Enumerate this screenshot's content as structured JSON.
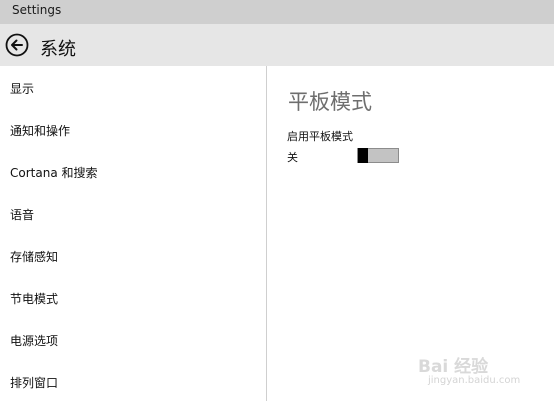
{
  "window": {
    "title": "Settings"
  },
  "header": {
    "title": "系统",
    "back_icon": "back-arrow-icon"
  },
  "sidebar": {
    "items": [
      {
        "label": "显示"
      },
      {
        "label": "通知和操作"
      },
      {
        "label": "Cortana 和搜索"
      },
      {
        "label": "语音"
      },
      {
        "label": "存储感知"
      },
      {
        "label": "节电模式"
      },
      {
        "label": "电源选项"
      },
      {
        "label": "排列窗口"
      }
    ]
  },
  "main": {
    "section_title": "平板模式",
    "setting_label": "启用平板模式",
    "toggle_state_text": "关",
    "toggle_on": false
  },
  "watermark": {
    "logo_text": "Bai 经验",
    "url": "jingyan.baidu.com"
  },
  "colors": {
    "titlebar": "#cfcfcf",
    "header": "#e6e6e6",
    "section_title": "#6e6e6e",
    "toggle_track": "#c3c3c3",
    "toggle_knob": "#000000"
  }
}
